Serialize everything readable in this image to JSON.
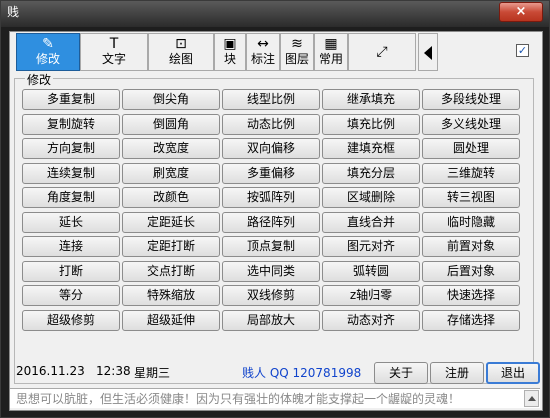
{
  "window": {
    "title": "贱",
    "close_glyph": "×"
  },
  "toolbar": {
    "tabs": [
      {
        "label": "修改",
        "icon": "pencil-icon",
        "glyph": "✎"
      },
      {
        "label": "文字",
        "icon": "text-icon",
        "glyph": "T"
      },
      {
        "label": "绘图",
        "icon": "draw-icon",
        "glyph": "⊡"
      },
      {
        "label": "块",
        "icon": "block-icon",
        "glyph": "▣"
      },
      {
        "label": "标注",
        "icon": "dimension-icon",
        "glyph": "↔"
      },
      {
        "label": "图层",
        "icon": "layers-icon",
        "glyph": "≋"
      },
      {
        "label": "常用",
        "icon": "grid-icon",
        "glyph": "▦"
      },
      {
        "label": "",
        "icon": "export-icon",
        "glyph": "⤢"
      }
    ],
    "checkbox_checked": true
  },
  "group": {
    "title": "修改",
    "buttons": [
      [
        "多重复制",
        "倒尖角",
        "线型比例",
        "继承填充",
        "多段线处理"
      ],
      [
        "复制旋转",
        "倒圆角",
        "动态比例",
        "填充比例",
        "多义线处理"
      ],
      [
        "方向复制",
        "改宽度",
        "双向偏移",
        "建填充框",
        "圆处理"
      ],
      [
        "连续复制",
        "刷宽度",
        "多重偏移",
        "填充分层",
        "三维旋转"
      ],
      [
        "角度复制",
        "改颜色",
        "按弧阵列",
        "区域删除",
        "转三视图"
      ],
      [
        "延长",
        "定距延长",
        "路径阵列",
        "直线合并",
        "临时隐藏"
      ],
      [
        "连接",
        "定距打断",
        "顶点复制",
        "图元对齐",
        "前置对象"
      ],
      [
        "打断",
        "交点打断",
        "选中同类",
        "弧转圆",
        "后置对象"
      ],
      [
        "等分",
        "特殊缩放",
        "双线修剪",
        "z轴归零",
        "快速选择"
      ],
      [
        "超级修剪",
        "超级延伸",
        "局部放大",
        "动态对齐",
        "存储选择"
      ]
    ]
  },
  "status": {
    "date": "2016.11.23",
    "time": "12:38",
    "weekday": "星期三",
    "author": "贱人 QQ 120781998",
    "about_label": "关于",
    "register_label": "注册",
    "exit_label": "退出"
  },
  "motto": "思想可以肮脏，但生活必须健康！因为只有强壮的体魄才能支撑起一个龌龊的灵魂！",
  "colors": {
    "active_tab": "#2f8fe0",
    "author_text": "#1144cc"
  }
}
